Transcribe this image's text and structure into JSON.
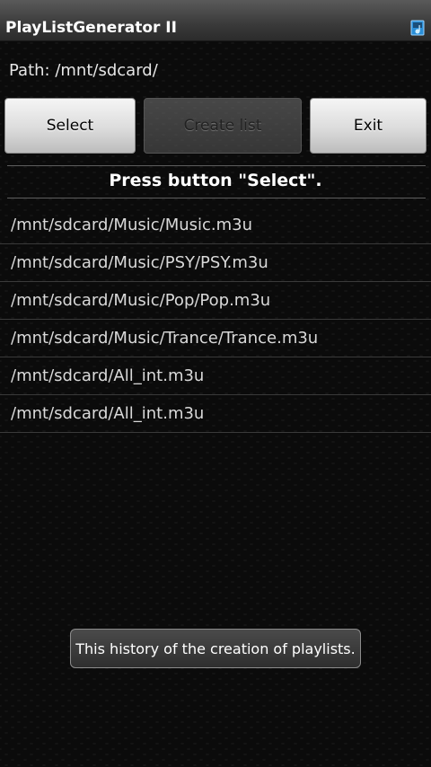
{
  "app": {
    "title": "PlayListGenerator II",
    "icon": "app-icon"
  },
  "path": {
    "label": "Path: /mnt/sdcard/"
  },
  "buttons": {
    "select_label": "Select",
    "create_list_label": "Create list",
    "create_list_enabled": false,
    "exit_label": "Exit"
  },
  "status": {
    "message": "Press button \"Select\"."
  },
  "history": {
    "items": [
      "/mnt/sdcard/Music/Music.m3u",
      "/mnt/sdcard/Music/PSY/PSY.m3u",
      "/mnt/sdcard/Music/Pop/Pop.m3u",
      "/mnt/sdcard/Music/Trance/Trance.m3u",
      "/mnt/sdcard/All_int.m3u",
      "/mnt/sdcard/All_int.m3u"
    ]
  },
  "toast": {
    "message": "This history of the creation of playlists."
  },
  "colors": {
    "background": "#1c1c1c",
    "title_bar": "#3a3a3a",
    "button_face": "#dcdcdc",
    "toast_border": "#8c8c8c"
  }
}
